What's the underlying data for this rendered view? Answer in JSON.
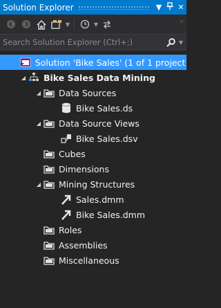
{
  "window": {
    "title": "Solution Explorer",
    "pin_glyph": "ᵸ",
    "dropdown_glyph": "▼",
    "close_glyph": "✕"
  },
  "toolbar": {
    "back_icon": "back-icon",
    "forward_icon": "forward-icon",
    "home_icon": "home-icon",
    "switch_views_icon": "solution-switch-icon",
    "history_icon": "history-icon",
    "sync_icon": "sync-icon",
    "overflow": "\""
  },
  "search": {
    "placeholder": "Search Solution Explorer (Ctrl+;)"
  },
  "tree": {
    "solution": "Solution 'Bike Sales' (1 of 1 project)",
    "project": "Bike Sales Data Mining",
    "data_sources": "Data Sources",
    "data_source_file": "Bike Sales.ds",
    "data_source_views": "Data Source Views",
    "data_source_view_file": "Bike Sales.dsv",
    "cubes": "Cubes",
    "dimensions": "Dimensions",
    "mining_structures": "Mining Structures",
    "mining_file_1": "Sales.dmm",
    "mining_file_2": "Bike Sales.dmm",
    "roles": "Roles",
    "assemblies": "Assemblies",
    "miscellaneous": "Miscellaneous"
  },
  "colors": {
    "accent": "#007acc",
    "selection": "#3399ff",
    "background": "#252526"
  }
}
